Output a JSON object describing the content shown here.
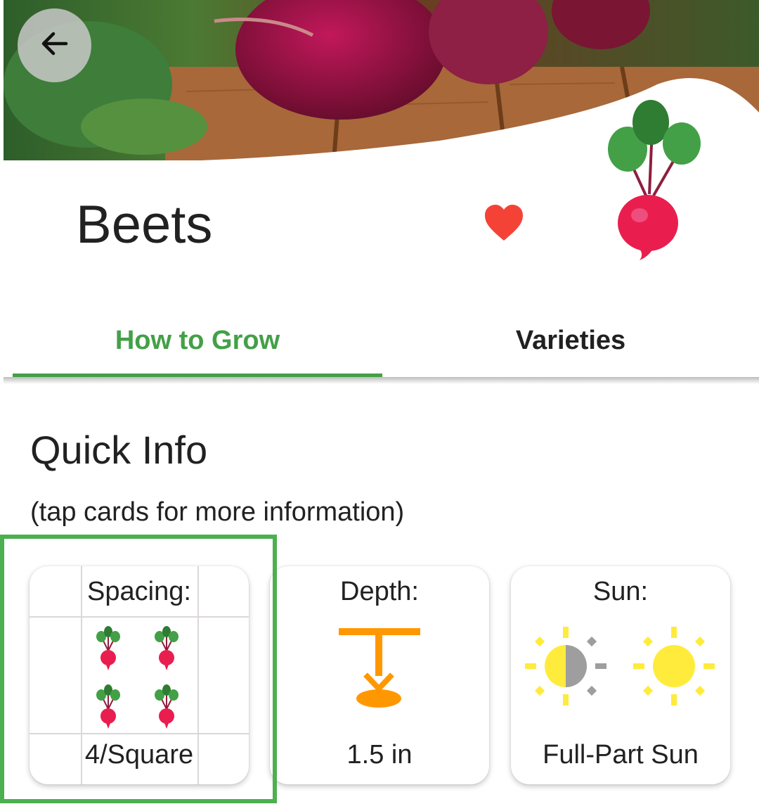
{
  "plant": {
    "name": "Beets",
    "favorite": true
  },
  "tabs": [
    {
      "label": "How to Grow",
      "active": true
    },
    {
      "label": "Varieties",
      "active": false
    }
  ],
  "quick_info": {
    "title": "Quick Info",
    "hint": "(tap cards for more information)",
    "cards": [
      {
        "label": "Spacing:",
        "value": "4/Square",
        "icon": "beet-grid-icon"
      },
      {
        "label": "Depth:",
        "value": "1.5 in",
        "icon": "seed-depth-icon"
      },
      {
        "label": "Sun:",
        "value": "Full-Part Sun",
        "icon": "sun-icon"
      }
    ]
  },
  "colors": {
    "accent": "#43a047",
    "highlight": "#4caf50",
    "heart": "#f44336",
    "depth_icon": "#ff9800",
    "sun": "#ffeb3b"
  },
  "icons": {
    "back": "arrow-left-icon",
    "favorite": "heart-icon",
    "plant": "beet-icon"
  }
}
